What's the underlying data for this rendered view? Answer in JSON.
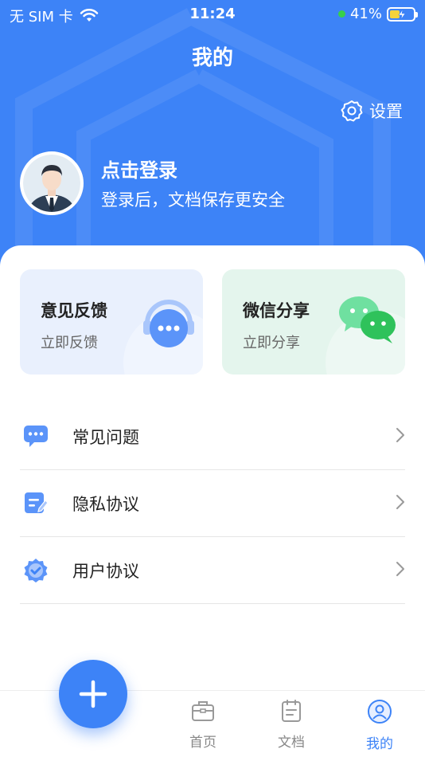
{
  "status_bar": {
    "carrier": "无 SIM 卡",
    "time": "11:24",
    "battery": "41%",
    "battery_level": 0.41
  },
  "header": {
    "title": "我的",
    "settings_label": "设置"
  },
  "profile": {
    "login_title": "点击登录",
    "login_subtitle": "登录后，文档保存更安全"
  },
  "quick_actions": [
    {
      "title": "意见反馈",
      "subtitle": "立即反馈",
      "icon": "headset-chat-icon"
    },
    {
      "title": "微信分享",
      "subtitle": "立即分享",
      "icon": "wechat-icon"
    }
  ],
  "menu": [
    {
      "label": "常见问题",
      "icon": "chat-bubble-icon"
    },
    {
      "label": "隐私协议",
      "icon": "edit-document-icon"
    },
    {
      "label": "用户协议",
      "icon": "verified-badge-icon"
    }
  ],
  "tabbar": {
    "items": [
      {
        "label": "首页",
        "icon": "briefcase-icon"
      },
      {
        "label": "文档",
        "icon": "document-icon"
      },
      {
        "label": "我的",
        "icon": "user-icon"
      }
    ],
    "active": "我的"
  },
  "colors": {
    "primary": "#3d83f7",
    "feedback_bg": "#e9f0fd",
    "share_bg": "#e4f5ed",
    "wechat_green": "#2fc25b"
  }
}
